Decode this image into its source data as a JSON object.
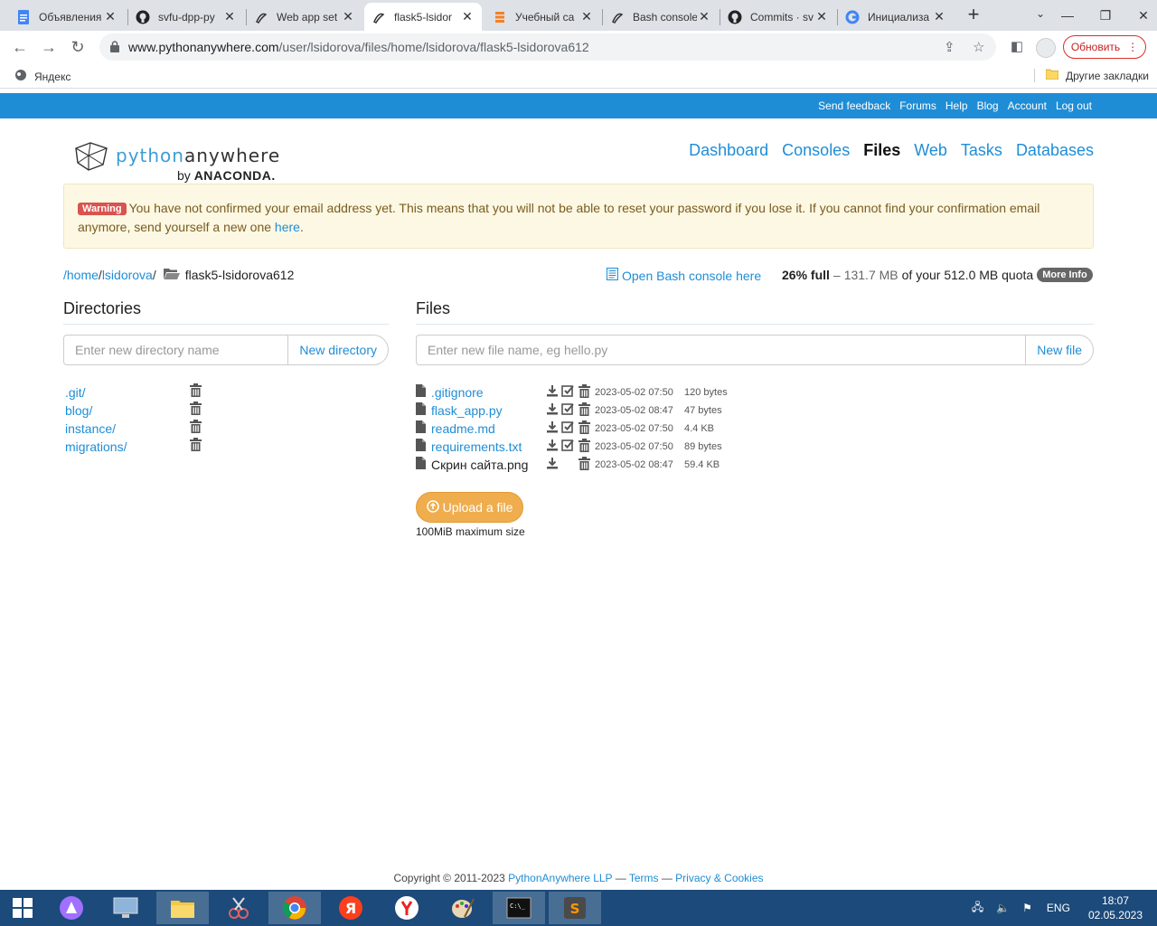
{
  "browser": {
    "tabs": [
      {
        "title": "Объявления",
        "icon": "docs-icon",
        "active": false
      },
      {
        "title": "svfu-dpp-py",
        "icon": "github-icon",
        "active": false
      },
      {
        "title": "Web app set",
        "icon": "pythonanywhere-icon",
        "active": false
      },
      {
        "title": "flask5-lsidor",
        "icon": "pythonanywhere-icon",
        "active": true
      },
      {
        "title": "Учебный са",
        "icon": "stack-icon",
        "active": false
      },
      {
        "title": "Bash console",
        "icon": "pythonanywhere-icon",
        "active": false
      },
      {
        "title": "Commits · sv",
        "icon": "github-icon",
        "active": false
      },
      {
        "title": "Инициализа",
        "icon": "google-icon",
        "active": false
      }
    ],
    "url_host": "www.pythonanywhere.com",
    "url_path": "/user/lsidorova/files/home/lsidorova/flask5-lsidorova612",
    "update_label": "Обновить",
    "bookmark_yandex": "Яндекс",
    "bookmark_other": "Другие закладки"
  },
  "topbar": {
    "links": [
      "Send feedback",
      "Forums",
      "Help",
      "Blog",
      "Account",
      "Log out"
    ]
  },
  "logo": {
    "python": "python",
    "anywhere": "anywhere",
    "by": "by",
    "anaconda": "ANACONDA."
  },
  "nav": {
    "items": [
      "Dashboard",
      "Consoles",
      "Files",
      "Web",
      "Tasks",
      "Databases"
    ],
    "active": "Files"
  },
  "warning": {
    "label": "Warning",
    "text": "You have not confirmed your email address yet. This means that you will not be able to reset your password if you lose it. If you cannot find your confirmation email anymore, send yourself a new one ",
    "link": "here",
    "end": "."
  },
  "breadcrumb": {
    "home": "/home",
    "user": "lsidorova",
    "slash1": "/",
    "slash2": "/",
    "current": "flask5-lsidorova612"
  },
  "bash_link": "Open Bash console here",
  "quota": {
    "percent": "26% full",
    "dash": "–",
    "used": "131.7 MB",
    "of_text": "of your 512.0 MB quota",
    "more": "More Info"
  },
  "directories": {
    "heading": "Directories",
    "placeholder": "Enter new directory name",
    "button": "New directory",
    "items": [
      ".git/",
      "blog/",
      "instance/",
      "migrations/"
    ]
  },
  "files": {
    "heading": "Files",
    "placeholder": "Enter new file name, eg hello.py",
    "button": "New file",
    "items": [
      {
        "name": ".gitignore",
        "date": "2023-05-02 07:50",
        "size": "120 bytes",
        "editable": true
      },
      {
        "name": "flask_app.py",
        "date": "2023-05-02 08:47",
        "size": "47 bytes",
        "editable": true
      },
      {
        "name": "readme.md",
        "date": "2023-05-02 07:50",
        "size": "4.4 KB",
        "editable": true
      },
      {
        "name": "requirements.txt",
        "date": "2023-05-02 07:50",
        "size": "89 bytes",
        "editable": true
      },
      {
        "name": "Скрин сайта.png",
        "date": "2023-05-02 08:47",
        "size": "59.4 KB",
        "editable": false
      }
    ],
    "upload": "Upload a file",
    "upload_note": "100MiB maximum size"
  },
  "footer": {
    "copyright": "Copyright © 2011-2023 ",
    "company": "PythonAnywhere LLP",
    "dash1": " — ",
    "terms": "Terms",
    "dash2": " — ",
    "privacy": "Privacy & Cookies"
  },
  "taskbar": {
    "lang": "ENG",
    "time": "18:07",
    "date": "02.05.2023"
  },
  "colors": {
    "accent": "#1f8dd6",
    "warning_bg": "#fcf8e3",
    "upload": "#f0ad4e",
    "taskbar": "#1c4a7a"
  }
}
